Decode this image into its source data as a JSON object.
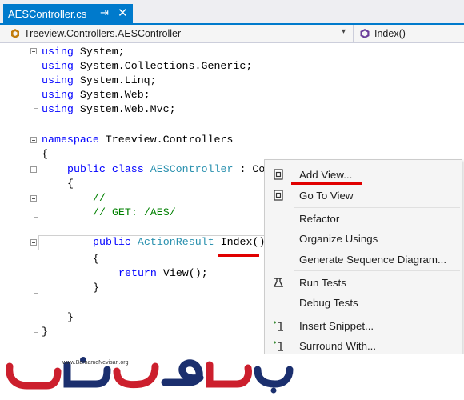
{
  "tab": {
    "title": "AESController.cs",
    "pin_glyph": "⇥",
    "close_glyph": "✕"
  },
  "navbar": {
    "left": "Treeview.Controllers.AESController",
    "right": "Index()"
  },
  "code": {
    "lines": [
      [
        "using",
        " System;"
      ],
      [
        "using",
        " System.Collections.Generic;"
      ],
      [
        "using",
        " System.Linq;"
      ],
      [
        "using",
        " System.Web;"
      ],
      [
        "using",
        " System.Web.Mvc;"
      ],
      [
        "namespace",
        " Treeview.Controllers"
      ],
      "{",
      [
        "public class",
        " ",
        "AESController",
        " : Co"
      ],
      "{",
      "//",
      "// GET: /AES/",
      [
        "public",
        " ",
        "ActionResult",
        " Index()"
      ],
      "{",
      [
        "return",
        " View();"
      ],
      "}",
      "}",
      "}"
    ]
  },
  "context_menu": {
    "items": [
      {
        "label": "Add View...",
        "icon": "add-view-icon"
      },
      {
        "label": "Go To View",
        "icon": "go-to-view-icon"
      },
      {
        "label": "Refactor",
        "icon": ""
      },
      {
        "label": "Organize Usings",
        "icon": ""
      },
      {
        "label": "Generate Sequence Diagram...",
        "icon": ""
      },
      {
        "label": "Run Tests",
        "icon": "run-tests-icon"
      },
      {
        "label": "Debug Tests",
        "icon": ""
      },
      {
        "label": "Insert Snippet...",
        "icon": "insert-snippet-icon"
      },
      {
        "label": "Surround With...",
        "icon": "surround-with-icon"
      }
    ]
  },
  "logo": {
    "url": "www.BarnameNevisan.org",
    "text": "برنامه نویسان"
  },
  "colors": {
    "accent": "#007acc",
    "keyword": "#0000ff",
    "type": "#2b91af",
    "comment": "#008000",
    "highlight": "#e00000",
    "logo_red": "#cc1f2d",
    "logo_blue": "#1b2f6e"
  }
}
